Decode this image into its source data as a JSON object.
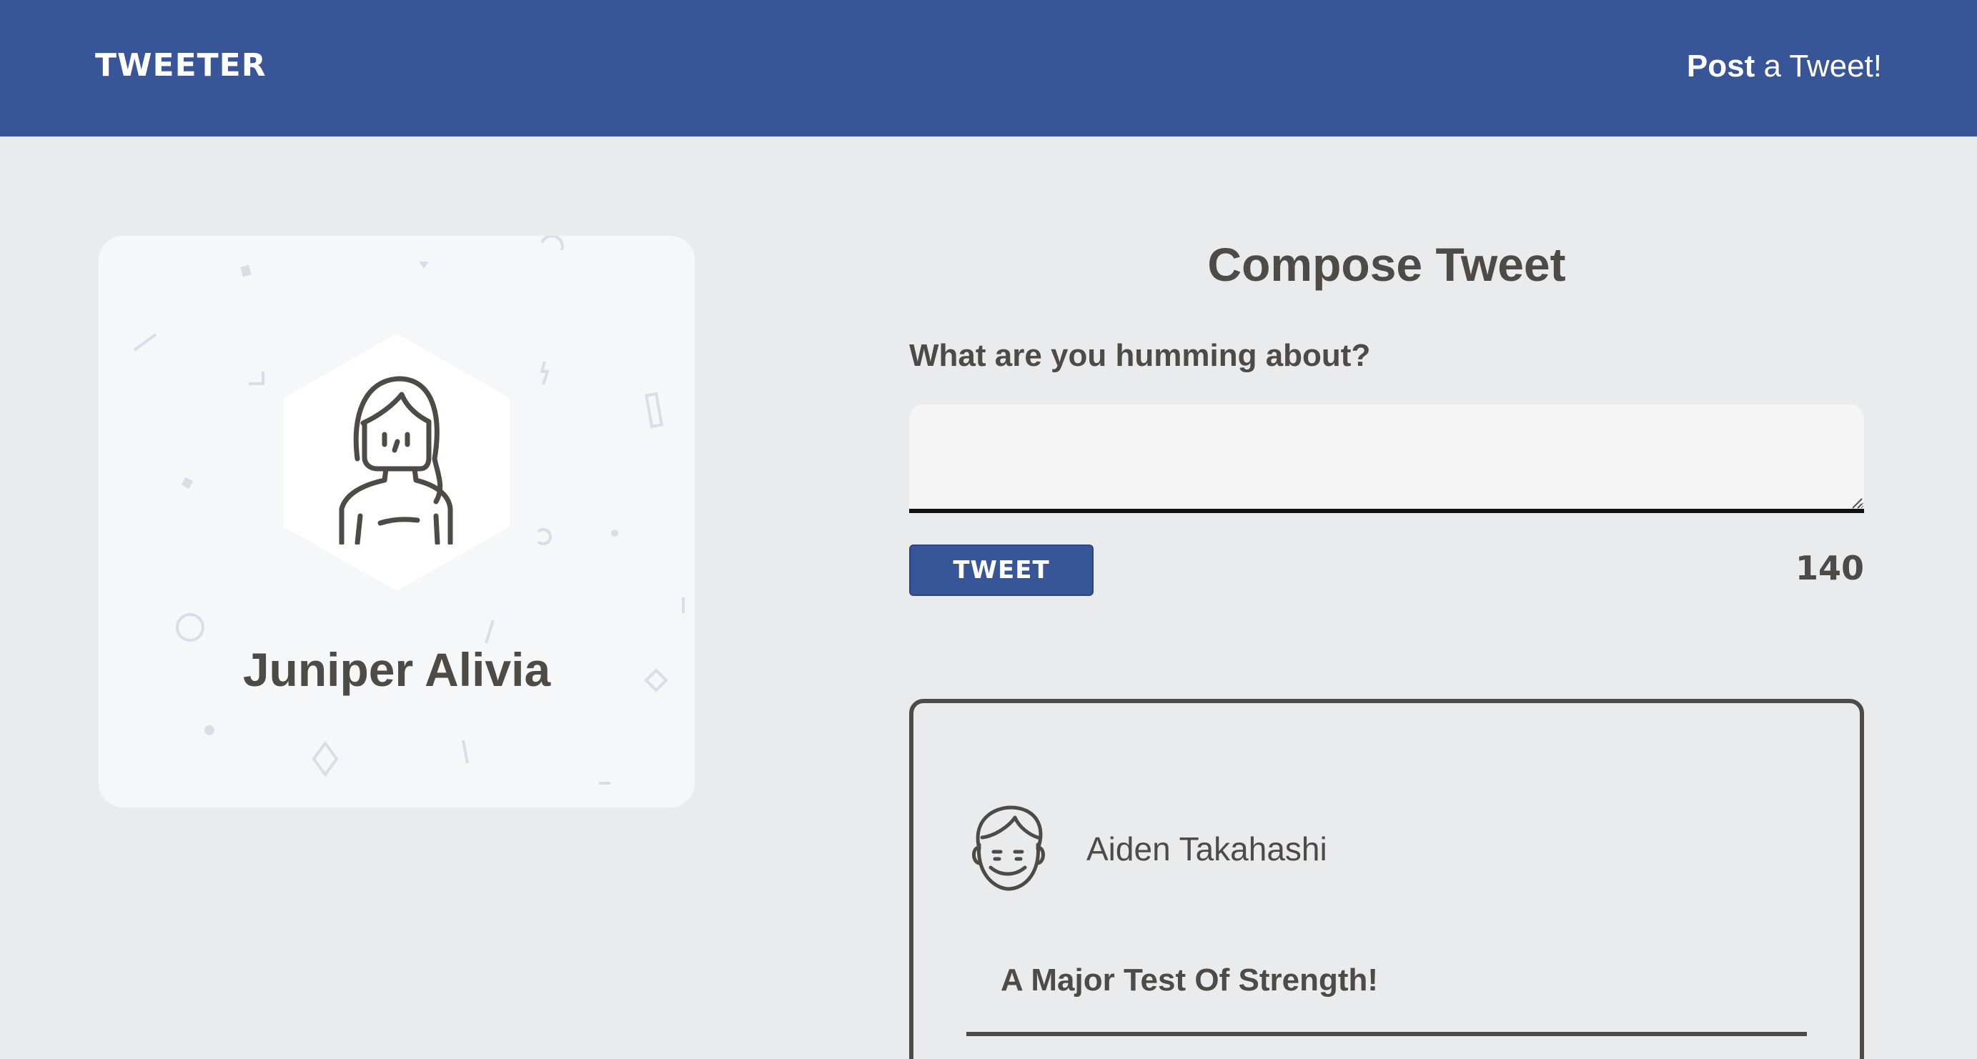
{
  "header": {
    "brand": "TWEETER",
    "nav_post_bold": "Post",
    "nav_post_rest": " a Tweet!"
  },
  "profile": {
    "name": "Juniper Alivia",
    "avatar_icon": "woman-avatar-icon"
  },
  "compose": {
    "title": "Compose Tweet",
    "label": "What are you humming about?",
    "input_value": "",
    "button_label": "TWEET",
    "char_count": "140"
  },
  "tweets": [
    {
      "author": "Aiden Takahashi",
      "avatar_icon": "man-avatar-icon",
      "text": "A Major Test Of Strength!"
    }
  ],
  "colors": {
    "header_bg": "#385597",
    "page_bg": "#eaebed",
    "card_bg": "#f6f7f9",
    "text": "#4e4a45"
  }
}
